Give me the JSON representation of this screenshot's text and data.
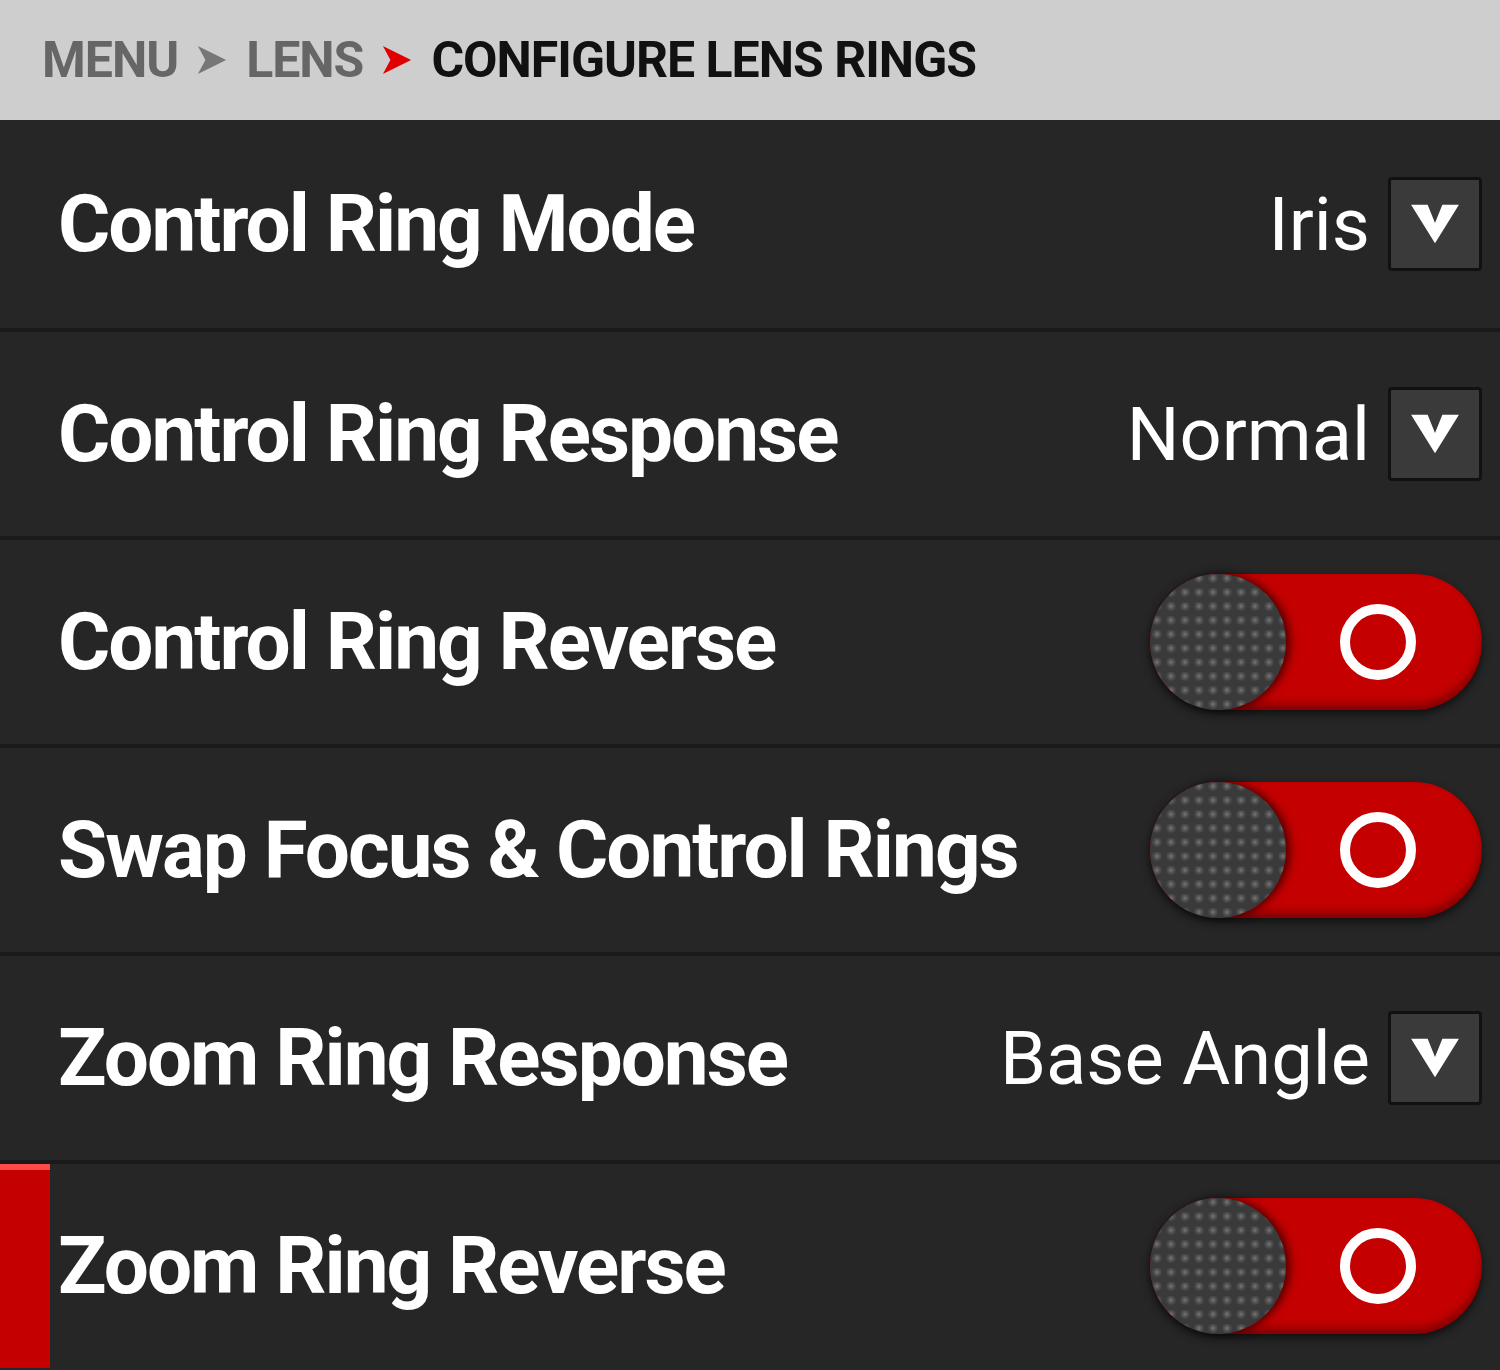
{
  "breadcrumb": [
    {
      "label": "MENU",
      "current": false
    },
    {
      "label": "LENS",
      "current": false
    },
    {
      "label": "CONFIGURE LENS RINGS",
      "current": true
    }
  ],
  "rows": [
    {
      "kind": "dropdown",
      "label": "Control Ring Mode",
      "value": "Iris",
      "selected": false
    },
    {
      "kind": "dropdown",
      "label": "Control Ring Response",
      "value": "Normal",
      "selected": false
    },
    {
      "kind": "toggle",
      "label": "Control Ring Reverse",
      "on": false,
      "selected": false
    },
    {
      "kind": "toggle",
      "label": "Swap Focus & Control Rings",
      "on": false,
      "selected": false
    },
    {
      "kind": "dropdown",
      "label": "Zoom Ring Response",
      "value": "Base Angle",
      "selected": false
    },
    {
      "kind": "toggle",
      "label": "Zoom Ring Reverse",
      "on": false,
      "selected": true
    }
  ]
}
